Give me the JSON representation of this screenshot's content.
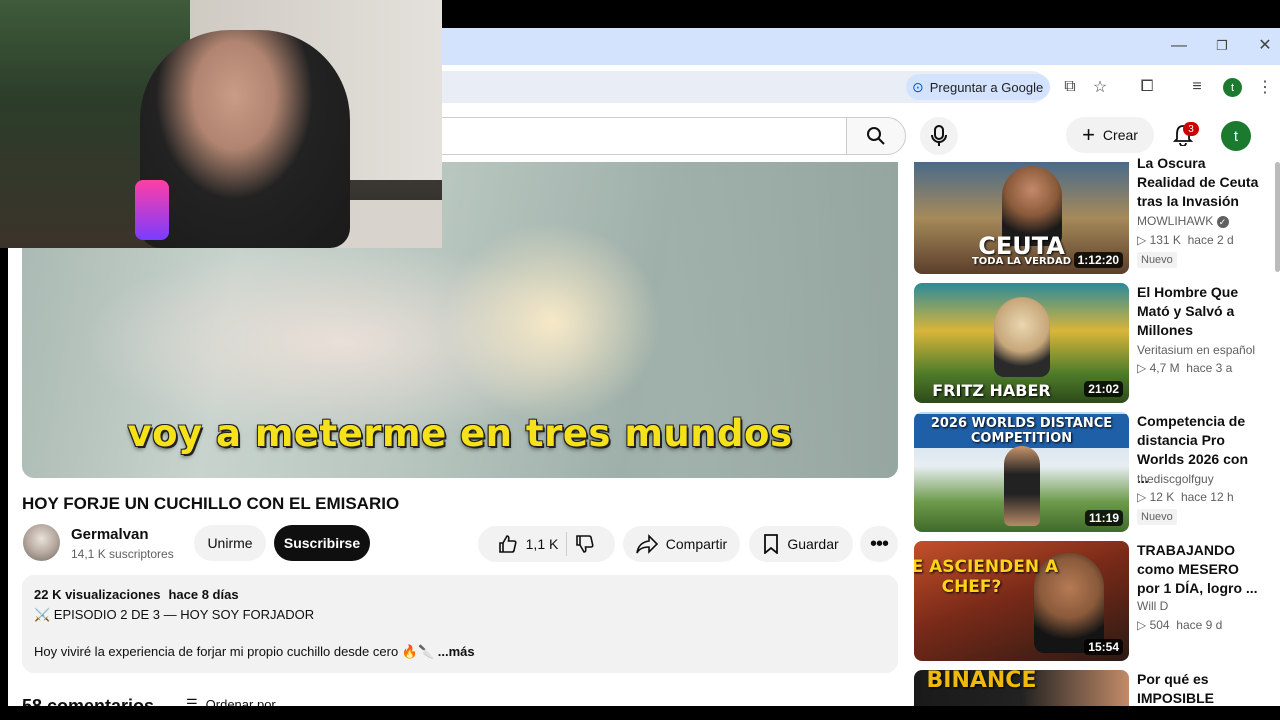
{
  "browser": {
    "ask_google": "Preguntar a Google",
    "profile_initial": "t"
  },
  "header": {
    "create_label": "Crear",
    "notifications_count": "3",
    "avatar_initial": "t"
  },
  "video": {
    "subtitle": "voy a meterme en tres mundos",
    "title": "HOY FORJE UN CUCHILLO CON EL EMISARIO"
  },
  "channel": {
    "name": "Germalvan",
    "subscribers": "14,1 K suscriptores",
    "join_label": "Unirme",
    "subscribe_label": "Suscribirse"
  },
  "actions": {
    "likes": "1,1 K",
    "share_label": "Compartir",
    "save_label": "Guardar"
  },
  "description": {
    "views": "22 K visualizaciones",
    "date": "hace 8 días",
    "episode": "⚔️ EPISODIO 2 DE 3 — HOY SOY FORJADOR",
    "text": "Hoy viviré la experiencia de forjar mi propio cuchillo desde cero 🔥🔪",
    "more": "...más"
  },
  "comments": {
    "heading": "58 comentarios",
    "sort_label": "Ordenar por"
  },
  "recommendations": [
    {
      "title": "La Oscura Realidad de Ceuta tras la Invasión",
      "channel": "MOWLIHAWK",
      "views": "131 K",
      "age": "hace 2 d",
      "duration": "1:12:20",
      "badge": "Nuevo",
      "thumb_text": "CEUTA",
      "thumb_subtext": "TODA LA VERDAD"
    },
    {
      "title": "El Hombre Que Mató y Salvó a Millones",
      "channel": "Veritasium en español",
      "views": "4,7 M",
      "age": "hace 3 a",
      "duration": "21:02",
      "thumb_text": "FRITZ HABER"
    },
    {
      "title": "Competencia de distancia Pro Worlds 2026 con ...",
      "channel": "thediscgolfguy",
      "views": "12 K",
      "age": "hace 12 h",
      "duration": "11:19",
      "badge": "Nuevo",
      "thumb_text": "2026 WORLDS DISTANCE COMPETITION"
    },
    {
      "title": "TRABAJANDO como MESERO por 1 DÍA, logro ...",
      "channel": "Will D",
      "views": "504",
      "age": "hace 9 d",
      "duration": "15:54",
      "thumb_text": "¿ME ASCIENDEN A CHEF?"
    },
    {
      "title": "Por qué es IMPOSIBLE derrocar",
      "thumb_text": "BINANCE"
    }
  ]
}
